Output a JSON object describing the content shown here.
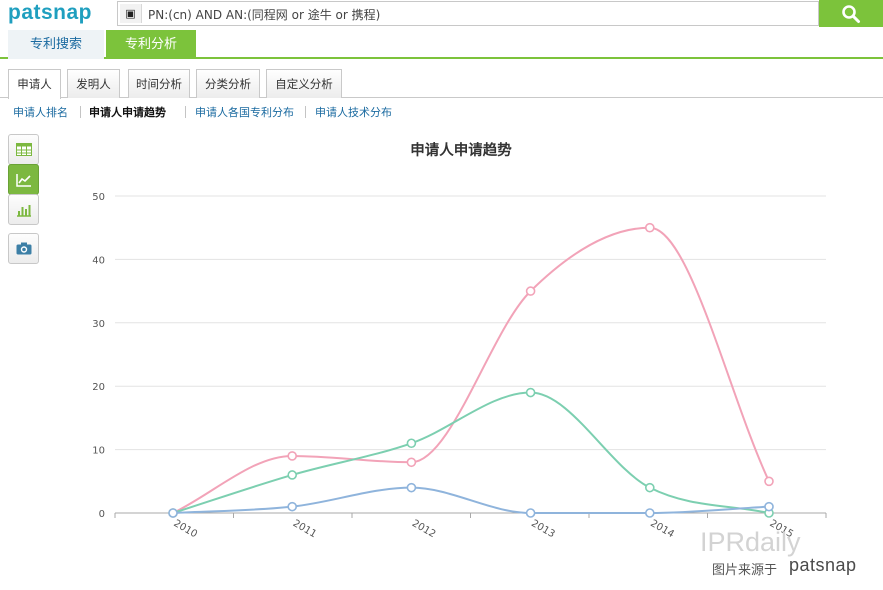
{
  "app": {
    "logo": "patsnap",
    "search_value": "PN:(cn) AND AN:(同程网 or 途牛 or 携程)",
    "search_type_icon": "db-icon",
    "search_button_icon": "search-icon"
  },
  "nav": {
    "tabs": [
      {
        "label": "专利搜索"
      },
      {
        "label": "专利分析",
        "active": true
      }
    ]
  },
  "subtabs": [
    {
      "label": "申请人",
      "active": true
    },
    {
      "label": "发明人"
    },
    {
      "label": "时间分析"
    },
    {
      "label": "分类分析"
    },
    {
      "label": "自定义分析"
    }
  ],
  "links": [
    {
      "label": "申请人排名"
    },
    {
      "label": "申请人申请趋势",
      "active": true
    },
    {
      "label": "申请人各国专利分布"
    },
    {
      "label": "申请人技术分布"
    }
  ],
  "tools": [
    "table-icon",
    "line-chart-icon",
    "bar-chart-icon",
    "camera-icon"
  ],
  "watermark": {
    "brand": "IPRdaily",
    "caption": "图片来源于",
    "source": "patsnap"
  },
  "chart_data": {
    "type": "line",
    "title": "申请人申请趋势",
    "categories": [
      "2010",
      "2011",
      "2012",
      "2013",
      "2014",
      "2015"
    ],
    "ylim": [
      0,
      50
    ],
    "yticks": [
      0,
      10,
      20,
      30,
      40,
      50
    ],
    "grid": true,
    "series": [
      {
        "color": "#f2a3b8",
        "values": [
          0,
          9,
          8,
          35,
          45,
          5
        ]
      },
      {
        "color": "#7ccfb0",
        "values": [
          0,
          6,
          11,
          19,
          4,
          0
        ]
      },
      {
        "color": "#8fb4dc",
        "values": [
          0,
          1,
          4,
          0,
          0,
          1
        ]
      }
    ]
  }
}
